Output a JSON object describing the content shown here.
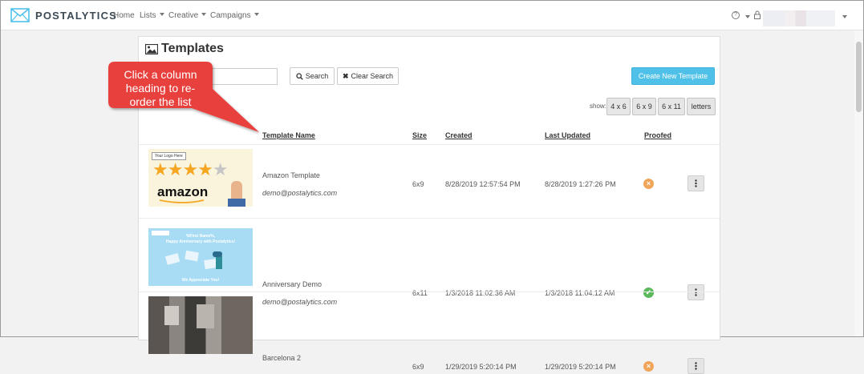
{
  "nav": {
    "brand": "POSTALYTICS",
    "items": [
      {
        "label": "Home",
        "dropdown": false
      },
      {
        "label": "Lists",
        "dropdown": true
      },
      {
        "label": "Creative",
        "dropdown": true
      },
      {
        "label": "Campaigns",
        "dropdown": true
      }
    ],
    "help_icon": "question-circle-icon",
    "user_icon": "lock-icon"
  },
  "page": {
    "title": "Templates",
    "title_icon": "image-icon",
    "search_value": "",
    "search_button": "Search",
    "clear_button": "Clear Search",
    "create_button": "Create New Template",
    "show_label": "show:",
    "size_filters": [
      "4 x 6",
      "6 x 9",
      "6 x 11",
      "letters"
    ]
  },
  "table": {
    "columns": [
      "Template Name",
      "Size",
      "Created",
      "Last Updated",
      "Proofed"
    ],
    "rows": [
      {
        "name": "Amazon Template",
        "owner": "demo@postalytics.com",
        "size": "6x9",
        "created": "8/28/2019 12:57:54 PM",
        "updated": "8/28/2019 1:27:26 PM",
        "proofed": false,
        "thumb": {
          "logo_text": "Your Logo Here",
          "brand": "amazon"
        }
      },
      {
        "name": "Anniversary Demo",
        "owner": "demo@postalytics.com",
        "size": "6x11",
        "created": "1/3/2018 11:02:36 AM",
        "updated": "1/3/2018 11:04:12 AM",
        "proofed": true,
        "thumb": {
          "line1": "%First Name%,",
          "line2": "Happy Anniversary with Postalytics!",
          "footer": "We Appreciate You!"
        }
      },
      {
        "name": "Barcelona 2",
        "owner": "",
        "size": "6x9",
        "created": "1/29/2019 5:20:14 PM",
        "updated": "1/29/2019 5:20:14 PM",
        "proofed": false,
        "thumb": {}
      }
    ]
  },
  "callout": {
    "text": "Click a column heading to re-order the list"
  },
  "colors": {
    "accent": "#4fc1e9",
    "callout": "#e8403c",
    "proofed_yes": "#5cb85c",
    "proofed_no": "#f0a65a"
  }
}
